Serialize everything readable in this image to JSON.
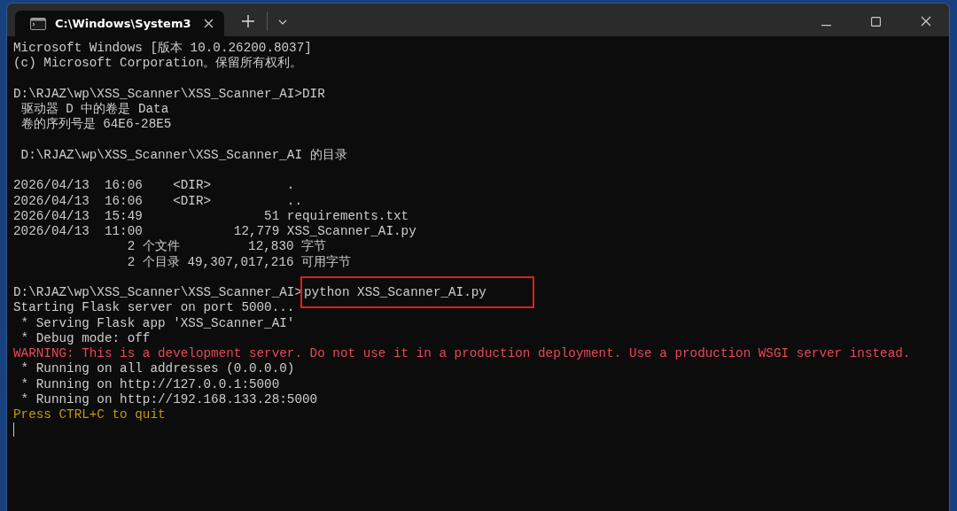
{
  "window": {
    "tab_title": "C:\\Windows\\System3"
  },
  "terminal": {
    "lines": [
      {
        "kind": "normal",
        "text": "Microsoft Windows [版本 10.0.26200.8037]"
      },
      {
        "kind": "normal",
        "text": "(c) Microsoft Corporation。保留所有权利。"
      },
      {
        "kind": "blank"
      },
      {
        "kind": "normal",
        "text": "D:\\RJAZ\\wp\\XSS_Scanner\\XSS_Scanner_AI>DIR"
      },
      {
        "kind": "normal",
        "text": " 驱动器 D 中的卷是 Data"
      },
      {
        "kind": "normal",
        "text": " 卷的序列号是 64E6-28E5"
      },
      {
        "kind": "blank"
      },
      {
        "kind": "normal",
        "text": " D:\\RJAZ\\wp\\XSS_Scanner\\XSS_Scanner_AI 的目录"
      },
      {
        "kind": "blank"
      },
      {
        "kind": "normal",
        "text": "2026/04/13  16:06    <DIR>          ."
      },
      {
        "kind": "normal",
        "text": "2026/04/13  16:06    <DIR>          .."
      },
      {
        "kind": "normal",
        "text": "2026/04/13  15:49                51 requirements.txt"
      },
      {
        "kind": "normal",
        "text": "2026/04/13  11:00            12,779 XSS_Scanner_AI.py"
      },
      {
        "kind": "normal",
        "text": "               2 个文件         12,830 字节"
      },
      {
        "kind": "normal",
        "text": "               2 个目录 49,307,017,216 可用字节"
      },
      {
        "kind": "blank"
      },
      {
        "kind": "command",
        "prompt": "D:\\RJAZ\\wp\\XSS_Scanner\\XSS_Scanner_AI>",
        "text": "python XSS_Scanner_AI.py",
        "highlighted": true
      },
      {
        "kind": "normal",
        "text": "Starting Flask server on port 5000..."
      },
      {
        "kind": "normal",
        "text": " * Serving Flask app 'XSS_Scanner_AI'"
      },
      {
        "kind": "normal",
        "text": " * Debug mode: off"
      },
      {
        "kind": "warning",
        "text": "WARNING: This is a development server. Do not use it in a production deployment. Use a production WSGI server instead."
      },
      {
        "kind": "normal",
        "text": " * Running on all addresses (0.0.0.0)"
      },
      {
        "kind": "normal",
        "text": " * Running on http://127.0.0.1:5000"
      },
      {
        "kind": "normal",
        "text": " * Running on http://192.168.133.28:5000"
      },
      {
        "kind": "notice",
        "text": "Press CTRL+C to quit"
      },
      {
        "kind": "cursor"
      }
    ]
  }
}
